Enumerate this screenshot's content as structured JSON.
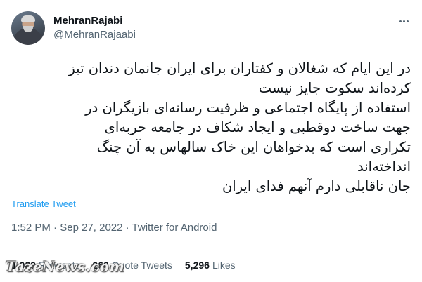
{
  "author": {
    "display_name": "MehranRajabi",
    "handle": "@MehranRajaabi"
  },
  "tweet": {
    "lines": [
      "در این ایام که شغالان و کفتاران برای ایران جانمان دندان تیز",
      "کرده‌اند سکوت جایز نیست",
      "استفاده از پایگاه اجتماعی و ظرفیت رسانه‌ای بازیگران در",
      "جهت ساخت دوقطبی و ایجاد شکاف در جامعه حربه‌ای",
      "تکراری است که بدخواهان این خاک سالهاس به آن چنگ",
      "انداخته‌اند",
      "جان ناقابلی دارم آنهم فدای ایران"
    ]
  },
  "translate_label": "Translate Tweet",
  "meta": {
    "time": "1:52 PM",
    "separator": " · ",
    "date": "Sep 27, 2022",
    "source": "Twitter for Android"
  },
  "stats": {
    "retweets_value": "1,089",
    "retweets_label": "Retweets",
    "quotes_value": "260",
    "quotes_label": "Quote Tweets",
    "likes_value": "5,296",
    "likes_label": "Likes"
  },
  "watermark": "TazeNews.com",
  "icons": {
    "more": "more-horizontal-icon"
  }
}
